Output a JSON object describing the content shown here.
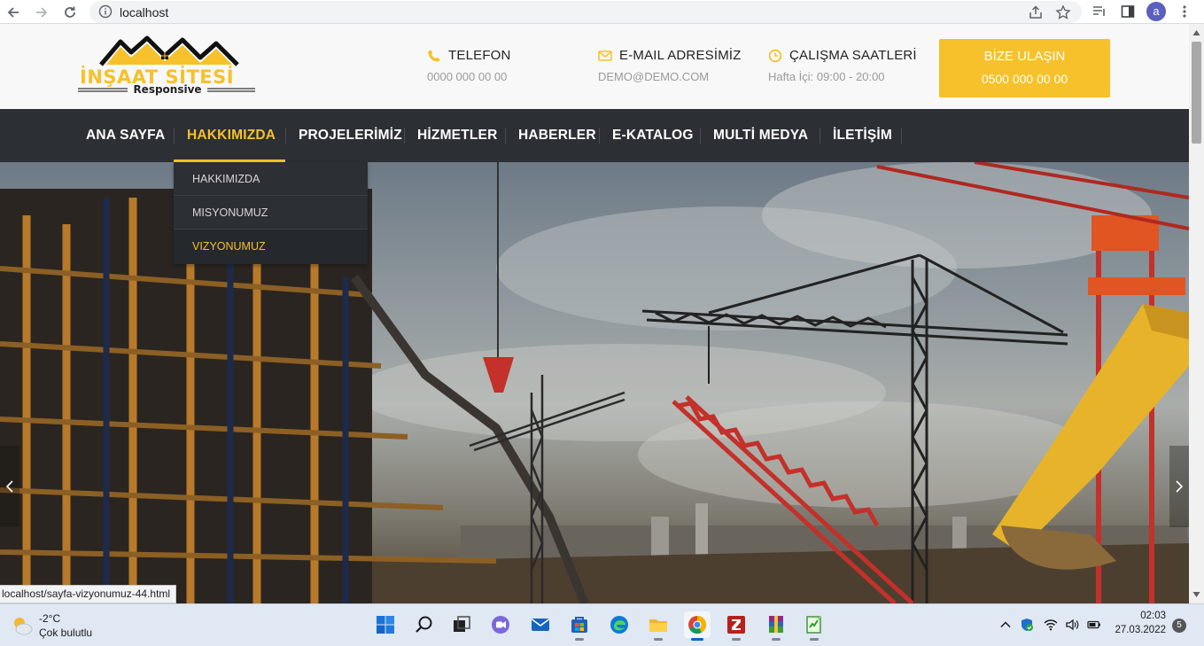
{
  "browser": {
    "url": "localhost",
    "profile_initial": "a",
    "status_url": "localhost/sayfa-vizyonumuz-44.html"
  },
  "header": {
    "logo_main": "İNŞAAT SİTESİ",
    "logo_sub": "Responsive",
    "phone": {
      "title": "TELEFON",
      "value": "0000 000 00 00",
      "icon": "phone-icon"
    },
    "email": {
      "title": "E-MAIL ADRESİMİZ",
      "value": "DEMO@DEMO.COM",
      "icon": "envelope-icon"
    },
    "hours": {
      "title": "ÇALIŞMA SAATLERİ",
      "value": "Hafta İçi: 09:00 - 20:00",
      "icon": "clock-icon"
    },
    "cta": {
      "title": "BİZE ULAŞIN",
      "value": "0500 000 00 00"
    }
  },
  "nav": {
    "items": [
      {
        "label": "ANA SAYFA"
      },
      {
        "label": "HAKKIMIZDA"
      },
      {
        "label": "PROJELERİMİZ"
      },
      {
        "label": "HİZMETLER"
      },
      {
        "label": "HABERLER"
      },
      {
        "label": "E-KATALOG"
      },
      {
        "label": "MULTİ MEDYA"
      },
      {
        "label": "İLETİŞİM"
      }
    ],
    "active_index": 1,
    "dropdown": [
      {
        "label": "HAKKIMIZDA"
      },
      {
        "label": "MISYONUMUZ"
      },
      {
        "label": "VIZYONUMUZ"
      }
    ]
  },
  "colors": {
    "accent": "#f6c12a",
    "nav_bg": "#2c2f34",
    "header_bg": "#f8f8f8"
  },
  "taskbar": {
    "weather": {
      "temp": "-2°C",
      "condition": "Çok bulutlu"
    },
    "apps": [
      "windows-start-icon",
      "search-icon",
      "task-view-icon",
      "chat-icon",
      "mail-icon",
      "store-icon",
      "edge-icon",
      "file-explorer-icon",
      "chrome-icon",
      "filezilla-icon",
      "winrar-icon",
      "notepad-icon"
    ],
    "time": "02:03",
    "date": "27.03.2022",
    "notifications": "5"
  }
}
